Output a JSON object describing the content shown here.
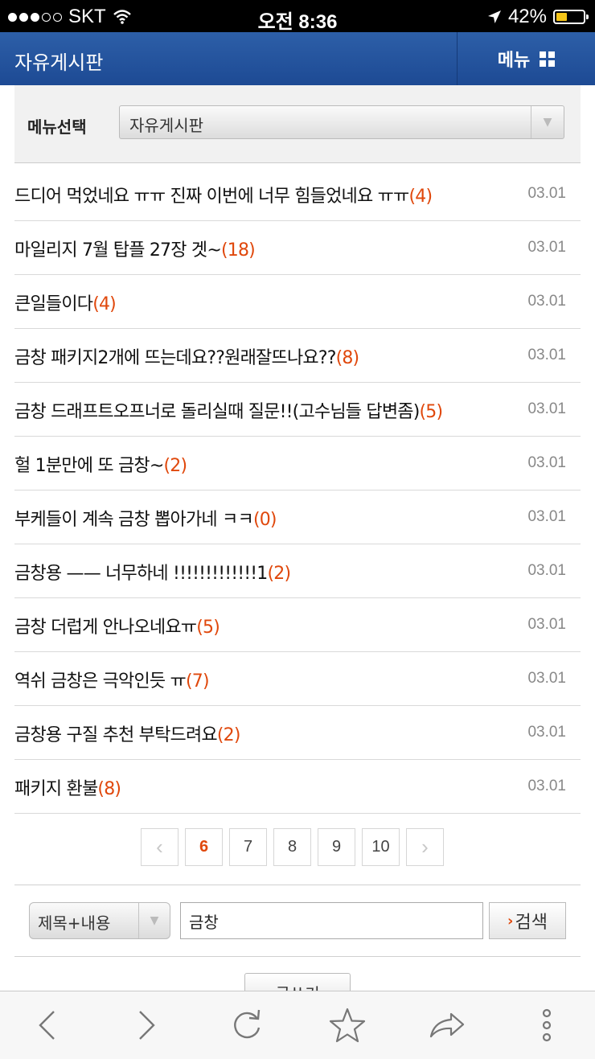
{
  "status_bar": {
    "carrier": "SKT",
    "time": "오전 8:36",
    "battery": "42%",
    "battery_level": 0.42
  },
  "header": {
    "title": "자유게시판",
    "menu_label": "메뉴"
  },
  "menu_select": {
    "label": "메뉴선택",
    "value": "자유게시판"
  },
  "posts": [
    {
      "title": "드디어 먹었네요 ㅠㅠ 진짜 이번에 너무 힘들었네요 ㅠㅠ",
      "count": "(4)",
      "date": "03.01"
    },
    {
      "title": "마일리지 7월 탑플 27장 겟~",
      "count": "(18)",
      "date": "03.01"
    },
    {
      "title": "큰일들이다",
      "count": "(4)",
      "date": "03.01"
    },
    {
      "title": "금창 패키지2개에 뜨는데요??원래잘뜨나요??",
      "count": "(8)",
      "date": "03.01"
    },
    {
      "title": "금창 드래프트오프너로 돌리실때 질문!!(고수님들 답변좀)",
      "count": "(5)",
      "date": "03.01"
    },
    {
      "title": "헐 1분만에 또 금창~",
      "count": "(2)",
      "date": "03.01"
    },
    {
      "title": "부케들이 계속 금창 뽑아가네 ㅋㅋ",
      "count": "(0)",
      "date": "03.01"
    },
    {
      "title": "금창용 —— 너무하네 !!!!!!!!!!!!!1",
      "count": "(2)",
      "date": "03.01"
    },
    {
      "title": "금창 더럽게 안나오네요ㅠ",
      "count": "(5)",
      "date": "03.01"
    },
    {
      "title": "역쉬 금창은 극악인듯 ㅠ",
      "count": "(7)",
      "date": "03.01"
    },
    {
      "title": "금창용 구질 추천 부탁드려요",
      "count": "(2)",
      "date": "03.01"
    },
    {
      "title": "패키지 환불",
      "count": "(8)",
      "date": "03.01"
    }
  ],
  "pagination": {
    "pages": [
      "6",
      "7",
      "8",
      "9",
      "10"
    ],
    "current": "6"
  },
  "search": {
    "scope": "제목+내용",
    "query": "금창",
    "button_label": "검색"
  },
  "write_button": "글쓰기",
  "colors": {
    "header": "#1d4a94",
    "accent": "#e0480c"
  }
}
